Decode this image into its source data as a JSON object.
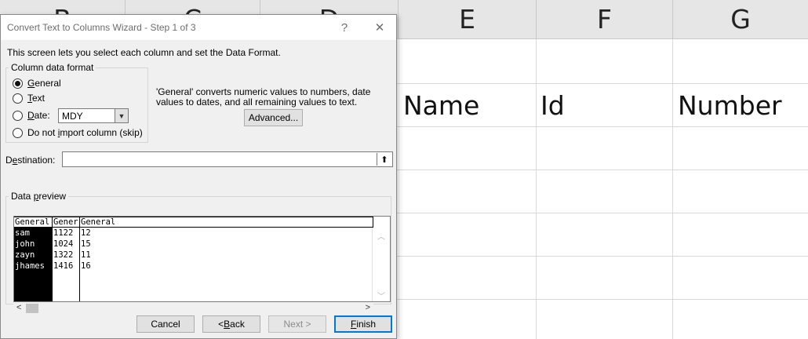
{
  "sheet": {
    "columns": [
      "B",
      "C",
      "D",
      "E",
      "F",
      "G"
    ],
    "row_values": {
      "E": "Name",
      "F": "Id",
      "G": "Number"
    }
  },
  "dialog": {
    "title": "Convert Text to Columns Wizard - Step 1 of 3",
    "help_glyph": "?",
    "close_glyph": "✕",
    "description": "This screen lets you select each column and set the Data Format.",
    "format_group": {
      "legend": "Column data format",
      "options": [
        {
          "pre": "",
          "key": "G",
          "post": "eneral",
          "selected": true
        },
        {
          "pre": "",
          "key": "T",
          "post": "ext",
          "selected": false
        },
        {
          "pre": "",
          "key": "D",
          "post": "ate:",
          "selected": false
        },
        {
          "pre": "Do not ",
          "key": "i",
          "post": "mport column (skip)",
          "selected": false
        }
      ],
      "date_format": "MDY"
    },
    "info_text": "'General' converts numeric values to numbers, date values to dates, and all remaining values to text.",
    "advanced_label": "Advanced...",
    "destination": {
      "pre": "D",
      "key": "e",
      "post": "stination:",
      "value": ""
    },
    "preview": {
      "legend_pre": "Data ",
      "legend_key": "p",
      "legend_post": "review",
      "columns": [
        {
          "header": "General",
          "cells": [
            "sam",
            "john",
            "zayn",
            "jhames"
          ]
        },
        {
          "header": "Gener",
          "cells": [
            "1122",
            "1024",
            "1322",
            "1416"
          ]
        },
        {
          "header": "General",
          "cells": [
            "12",
            "15",
            "11",
            "16"
          ]
        }
      ]
    },
    "buttons": {
      "cancel": "Cancel",
      "back_pre": "< ",
      "back_key": "B",
      "back_post": "ack",
      "next": "Next >",
      "finish_key": "F",
      "finish_post": "inish"
    }
  }
}
